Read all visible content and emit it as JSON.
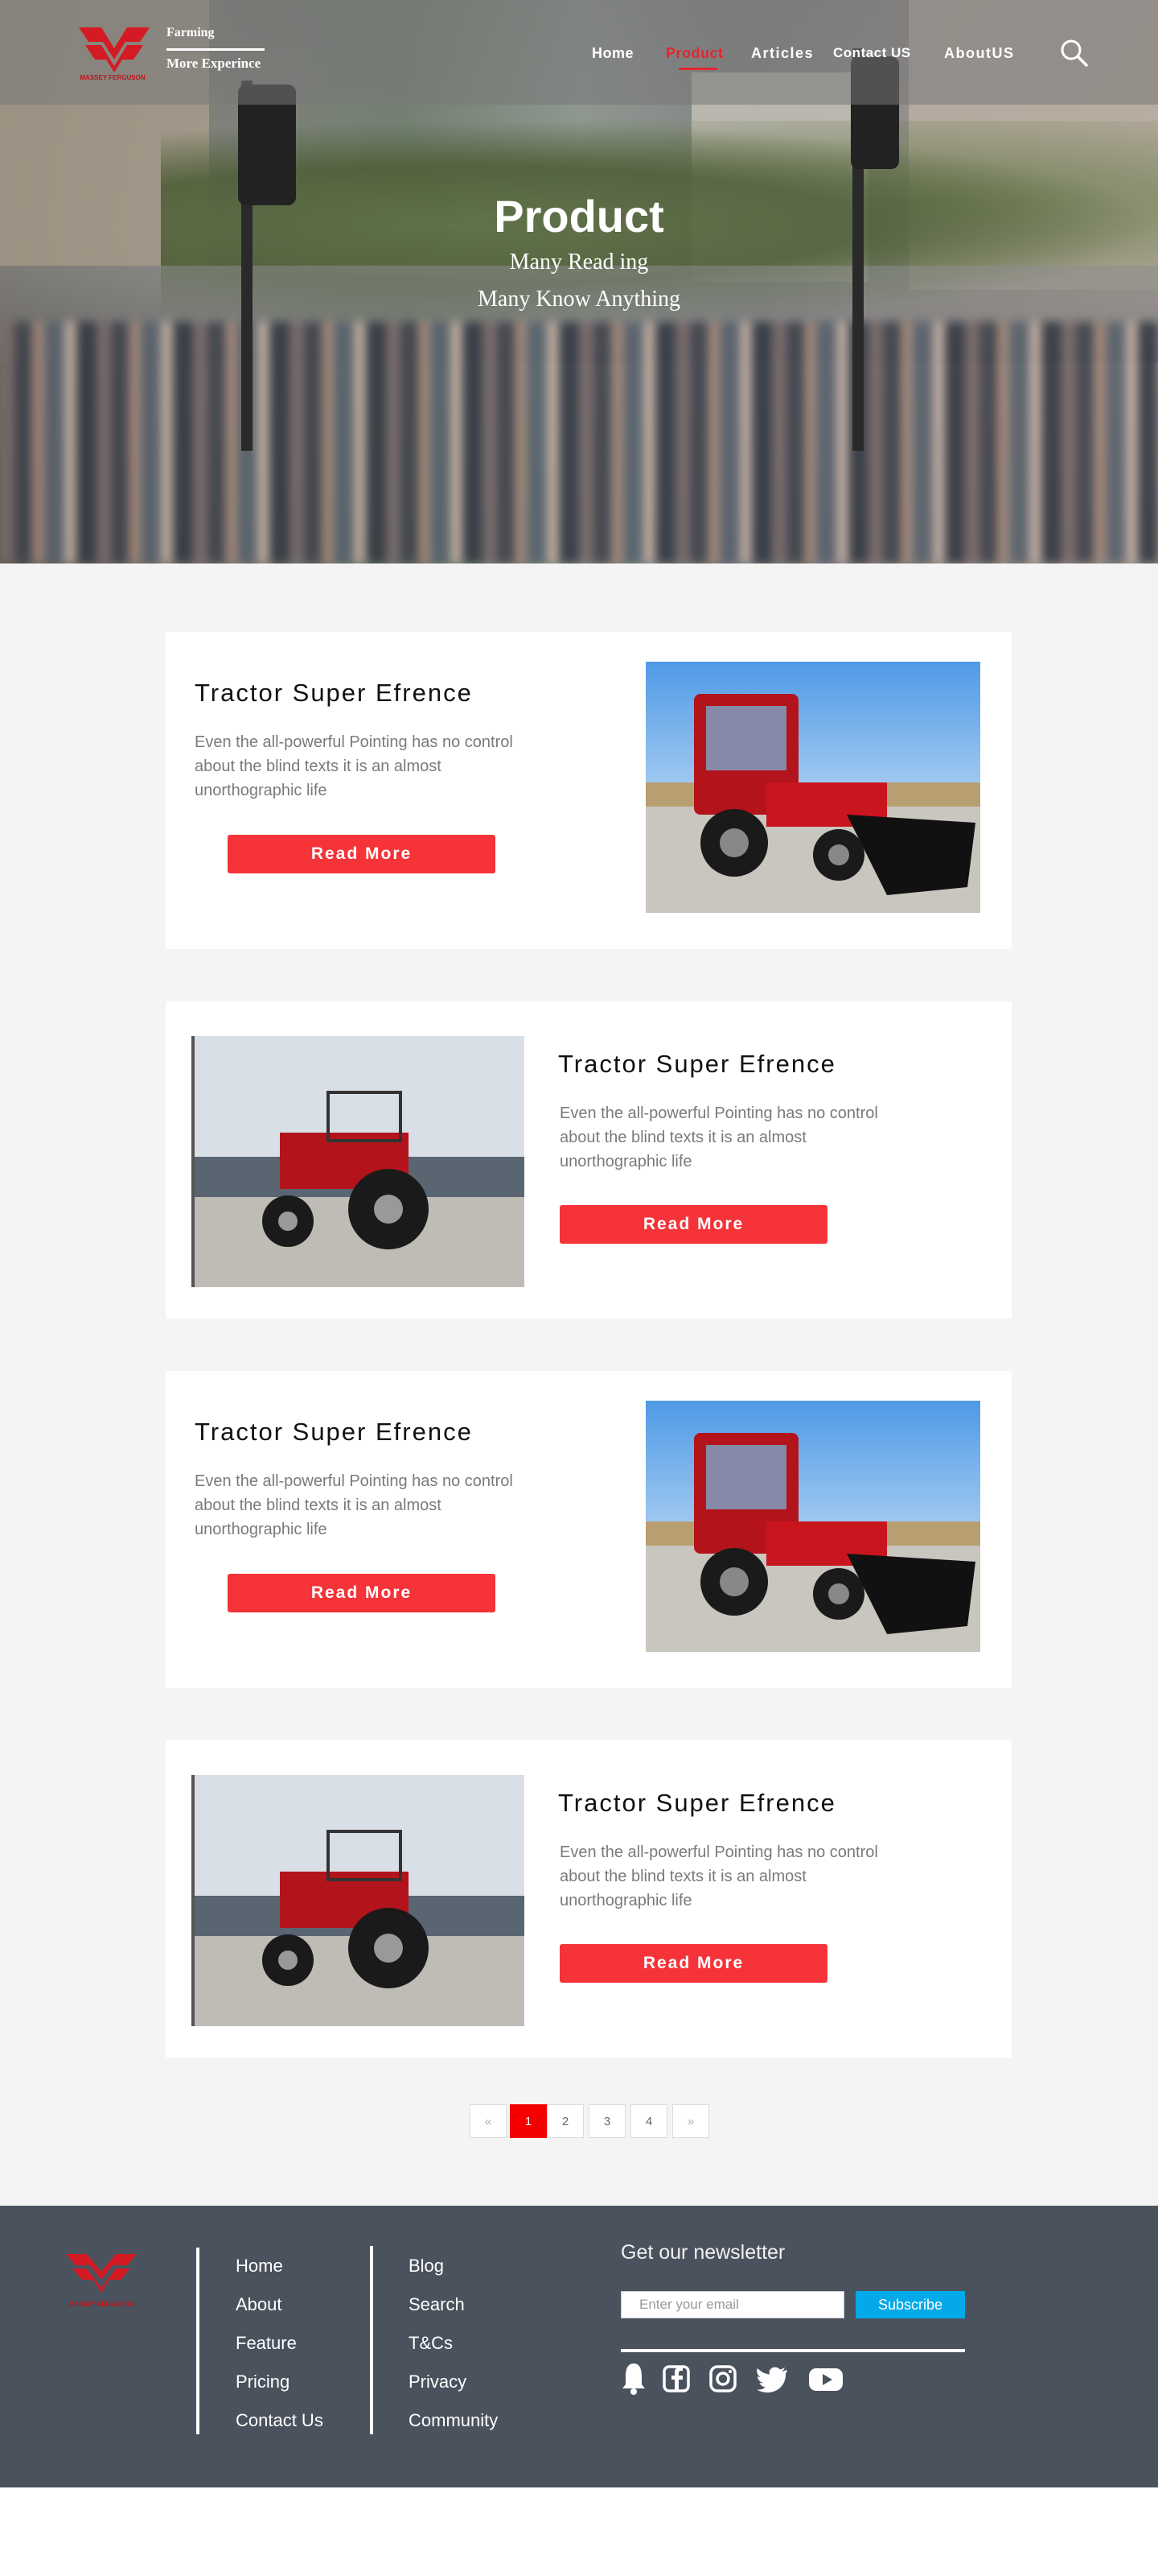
{
  "header": {
    "brand": "MASSEY FERGUSON",
    "tagline_top": "Farming",
    "tagline_bottom": "More Experince",
    "nav": [
      "Home",
      "Product",
      "Articles",
      "Contact US",
      "AboutUS"
    ],
    "active_nav": "Product"
  },
  "hero": {
    "title": "Product",
    "subtitle_line1": "Many Read ing",
    "subtitle_line2": "Many Know Anything"
  },
  "cards": [
    {
      "title": "Tractor Super Efrence",
      "description": "Even the all-powerful Pointing has no control about the blind texts it is an almost unorthographic life",
      "button": "Read More",
      "image": "red-backhoe-tractor"
    },
    {
      "title": "Tractor Super Efrence",
      "description": "Even the all-powerful Pointing has no control about the blind texts it is an almost unorthographic life",
      "button": "Read More",
      "image": "red-vintage-tractor"
    },
    {
      "title": "Tractor Super Efrence",
      "description": "Even the all-powerful Pointing has no control about the blind texts it is an almost unorthographic life",
      "button": "Read More",
      "image": "red-backhoe-tractor"
    },
    {
      "title": "Tractor Super Efrence",
      "description": "Even the all-powerful Pointing has no control about the blind texts it is an almost unorthographic life",
      "button": "Read More",
      "image": "red-vintage-tractor"
    }
  ],
  "pagination": {
    "prev": "«",
    "pages": [
      "1",
      "2",
      "3",
      "4"
    ],
    "next": "»",
    "current": "1"
  },
  "footer": {
    "brand": "MASSEY FERGUSON",
    "col1": [
      "Home",
      "About",
      "Feature",
      "Pricing",
      "Contact Us"
    ],
    "col2": [
      "Blog",
      "Search",
      "T&Cs",
      "Privacy",
      "Community"
    ],
    "newsletter_title": "Get our newsletter",
    "email_placeholder": "Enter your email",
    "subscribe_label": "Subscribe",
    "social_icons": [
      "bell-icon",
      "facebook-icon",
      "instagram-icon",
      "twitter-icon",
      "youtube-icon"
    ]
  },
  "colors": {
    "accent_red": "#f53339",
    "nav_active": "#e3262f",
    "footer_bg": "#4a525e",
    "subscribe_blue": "#03a9e9",
    "page_bg": "#f4f4f4"
  }
}
